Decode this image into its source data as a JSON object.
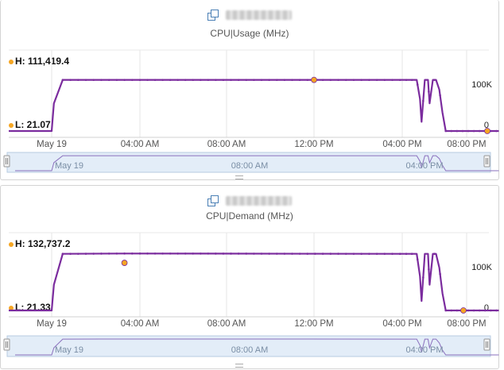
{
  "charts": [
    {
      "object_name": "vcenter-host-01",
      "metric": "CPU|Usage (MHz)",
      "high_label": "H: 111,419.4",
      "low_label": "L: 21.07",
      "y_tick_100k": "100K",
      "y_tick_0": "0",
      "x_ticks": [
        "May 19",
        "04:00 AM",
        "08:00 AM",
        "12:00 PM",
        "04:00 PM",
        "08:00 PM"
      ],
      "nav_ticks": [
        "May 19",
        "08:00 AM",
        "04:00 PM"
      ]
    },
    {
      "object_name": "vcenter-host-01",
      "metric": "CPU|Demand (MHz)",
      "high_label": "H: 132,737.2",
      "low_label": "L: 21.33",
      "y_tick_100k": "100K",
      "y_tick_0": "0",
      "x_ticks": [
        "May 19",
        "04:00 AM",
        "08:00 AM",
        "12:00 PM",
        "04:00 PM",
        "08:00 PM"
      ],
      "nav_ticks": [
        "May 19",
        "08:00 AM",
        "04:00 PM"
      ]
    }
  ],
  "colors": {
    "series": "#7b2c9e",
    "marker": "#f5a623",
    "navigator_bg": "#e3edf8",
    "grid": "#e6e6e6"
  },
  "chart_data": [
    {
      "type": "line",
      "title": "CPU|Usage (MHz)",
      "xlabel": "",
      "ylabel": "",
      "x_unit": "hours since 00:00 May 19 (x-axis shows May 19 00:00 to ~22:00)",
      "ylim": [
        0,
        111419.4
      ],
      "series": [
        {
          "name": "CPU|Usage (MHz)",
          "points": [
            [
              -1.3,
              21
            ],
            [
              0.0,
              21
            ],
            [
              0.1,
              60000
            ],
            [
              0.5,
              111000
            ],
            [
              12.0,
              111000
            ],
            [
              16.9,
              111000
            ],
            [
              17.1,
              70000
            ],
            [
              17.2,
              20000
            ],
            [
              17.4,
              111000
            ],
            [
              17.6,
              111000
            ],
            [
              17.7,
              60000
            ],
            [
              17.9,
              111000
            ],
            [
              18.1,
              111000
            ],
            [
              18.3,
              90000
            ],
            [
              18.5,
              40000
            ],
            [
              18.7,
              21
            ],
            [
              20.0,
              21
            ],
            [
              22.0,
              21
            ]
          ]
        }
      ],
      "high_point": [
        12.0,
        111419.4
      ],
      "low_point": [
        22.0,
        21.07
      ]
    },
    {
      "type": "line",
      "title": "CPU|Demand (MHz)",
      "xlabel": "",
      "ylabel": "",
      "x_unit": "hours since 00:00 May 19 (x-axis shows May 19 00:00 to ~22:00)",
      "ylim": [
        0,
        132737.2
      ],
      "series": [
        {
          "name": "CPU|Demand (MHz)",
          "points": [
            [
              -1.3,
              21
            ],
            [
              0.0,
              21
            ],
            [
              0.1,
              60000
            ],
            [
              0.5,
              132000
            ],
            [
              3.3,
              132737.2
            ],
            [
              16.9,
              132000
            ],
            [
              17.1,
              80000
            ],
            [
              17.2,
              22000
            ],
            [
              17.4,
              132000
            ],
            [
              17.6,
              132000
            ],
            [
              17.7,
              60000
            ],
            [
              17.9,
              132000
            ],
            [
              18.1,
              132000
            ],
            [
              18.3,
              100000
            ],
            [
              18.5,
              40000
            ],
            [
              18.7,
              21
            ],
            [
              19.8,
              21.33
            ],
            [
              22.0,
              21
            ]
          ]
        }
      ],
      "high_point": [
        3.3,
        132737.2
      ],
      "low_point": [
        19.8,
        21.33
      ]
    }
  ]
}
